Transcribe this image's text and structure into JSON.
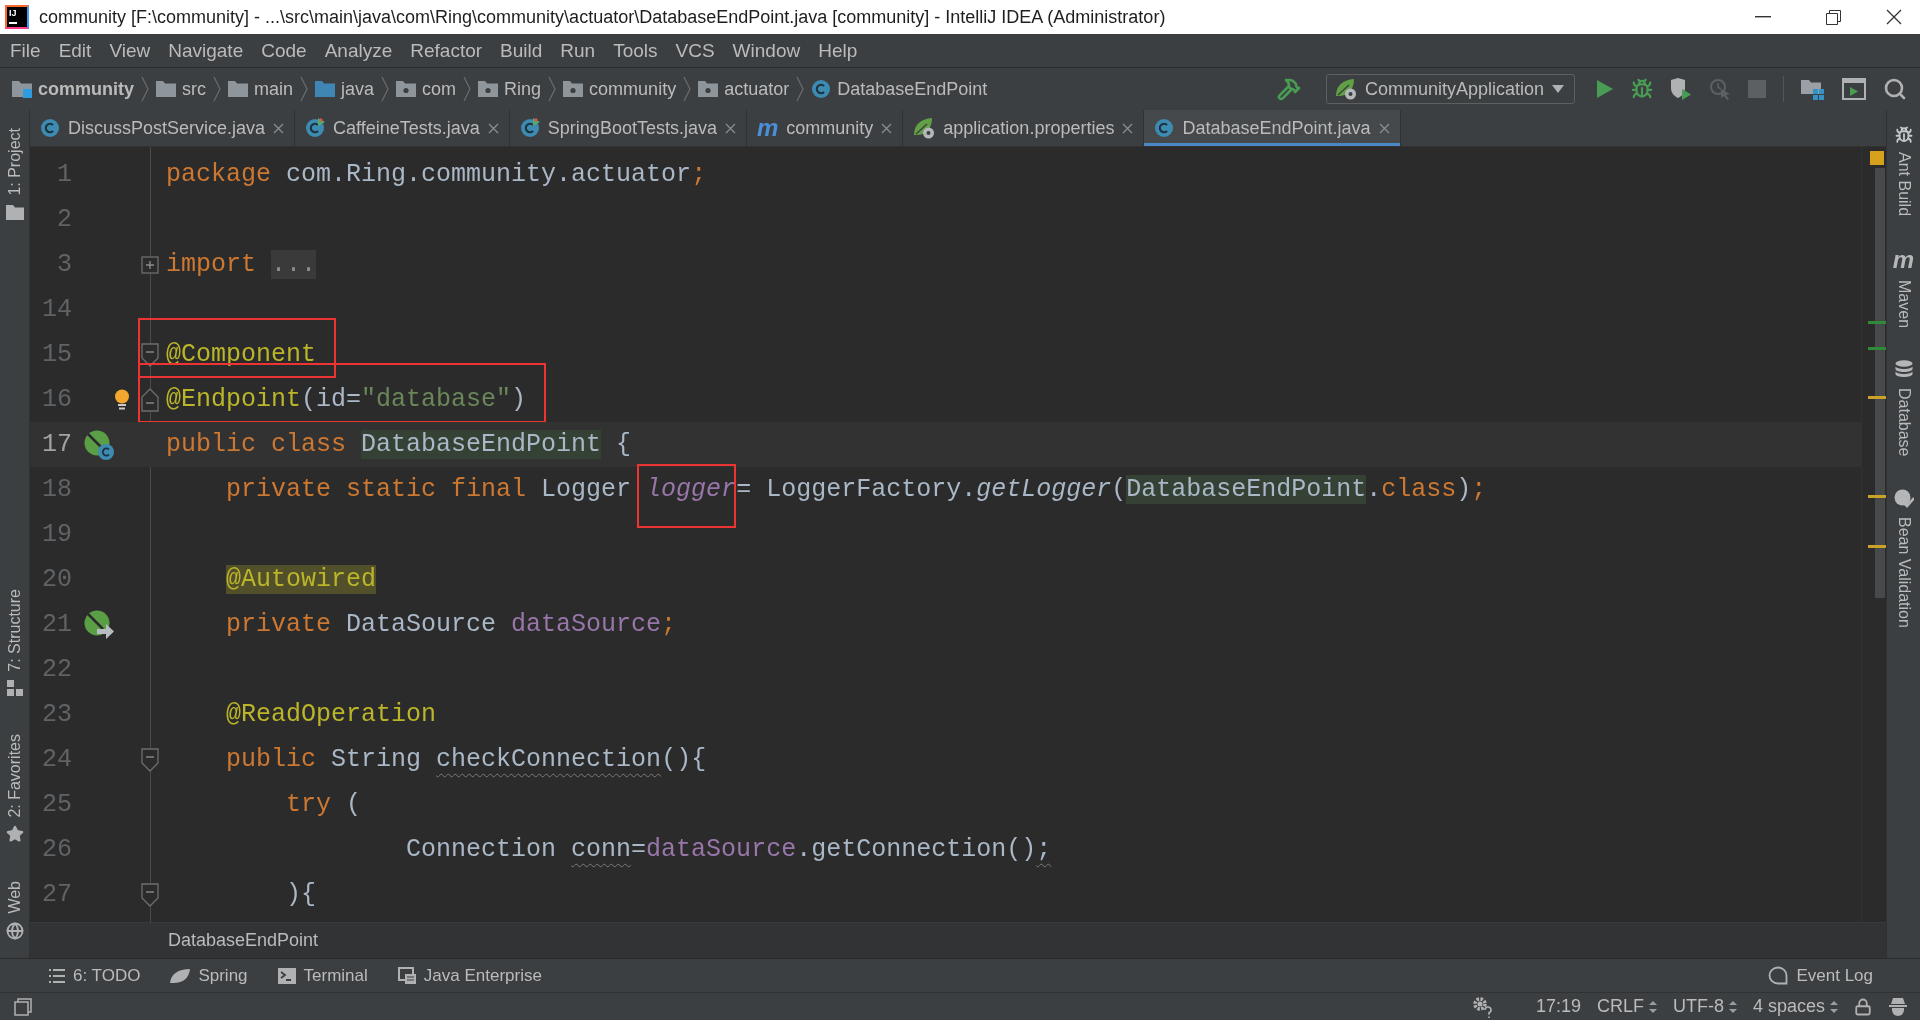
{
  "title_bar": {
    "logo_text": "IJ",
    "title": "community [F:\\community] - ...\\src\\main\\java\\com\\Ring\\community\\actuator\\DatabaseEndPoint.java [community] - IntelliJ IDEA (Administrator)"
  },
  "menu": [
    "File",
    "Edit",
    "View",
    "Navigate",
    "Code",
    "Analyze",
    "Refactor",
    "Build",
    "Run",
    "Tools",
    "VCS",
    "Window",
    "Help"
  ],
  "navigation": {
    "breadcrumbs": [
      {
        "label": "community",
        "kind": "module"
      },
      {
        "label": "src",
        "kind": "folder"
      },
      {
        "label": "main",
        "kind": "folder"
      },
      {
        "label": "java",
        "kind": "source-folder"
      },
      {
        "label": "com",
        "kind": "package"
      },
      {
        "label": "Ring",
        "kind": "package"
      },
      {
        "label": "community",
        "kind": "package"
      },
      {
        "label": "actuator",
        "kind": "package"
      },
      {
        "label": "DatabaseEndPoint",
        "kind": "class"
      }
    ],
    "toolbar": {
      "build": {
        "disabled": false
      },
      "run_config": {
        "label": "CommunityApplication"
      },
      "actions": [
        {
          "kind": "run",
          "disabled": false
        },
        {
          "kind": "debug",
          "disabled": false
        },
        {
          "kind": "coverage",
          "disabled": false
        },
        {
          "kind": "profile",
          "disabled": true
        },
        {
          "kind": "stop",
          "disabled": true
        }
      ],
      "tools": [
        {
          "kind": "project-structure"
        },
        {
          "kind": "run-window"
        },
        {
          "kind": "search"
        }
      ]
    }
  },
  "left_tool_strip": {
    "top": [
      {
        "label": "1: Project",
        "kind": "project"
      }
    ],
    "bottom": [
      {
        "label": "7: Structure",
        "kind": "structure"
      },
      {
        "label": "2: Favorites",
        "kind": "favorites"
      },
      {
        "label": "Web",
        "kind": "web"
      }
    ]
  },
  "tabs": [
    {
      "label": "DiscussPostService.java",
      "kind": "class",
      "selected": false
    },
    {
      "label": "CaffeineTests.java",
      "kind": "test",
      "selected": false
    },
    {
      "label": "SpringBootTests.java",
      "kind": "test",
      "selected": false
    },
    {
      "label": "community",
      "kind": "maven",
      "glyph": "m",
      "selected": false
    },
    {
      "label": "application.properties",
      "kind": "spring-config",
      "selected": false
    },
    {
      "label": "DatabaseEndPoint.java",
      "kind": "class",
      "selected": true
    }
  ],
  "editor": {
    "lines": [
      {
        "number": "1",
        "current": false,
        "marked": false,
        "tokens": [
          {
            "text": "package",
            "kind": "keyword"
          },
          {
            "text": " com.Ring.community.actuator",
            "kind": "plain"
          },
          {
            "text": ";",
            "kind": "keyword"
          }
        ]
      },
      {
        "number": "2",
        "current": false,
        "marked": false
      },
      {
        "number": "3",
        "current": false,
        "marked": false,
        "fold": {
          "kind": "expand"
        },
        "tokens": [
          {
            "text": "import ",
            "kind": "keyword"
          },
          {
            "text": "...",
            "kind": "folded"
          }
        ]
      },
      {
        "number": "14",
        "current": false,
        "marked": false
      },
      {
        "number": "15",
        "current": false,
        "marked": true,
        "fold": {
          "kind": "collapse"
        },
        "tokens": [
          {
            "text": "@Component",
            "kind": "annotation"
          }
        ]
      },
      {
        "number": "16",
        "current": false,
        "marked": true,
        "bulb": true,
        "fold": {
          "kind": "end"
        },
        "tokens": [
          {
            "text": "@Endpoint",
            "kind": "annotation"
          },
          {
            "text": "(id=",
            "kind": "plain"
          },
          {
            "text": "\"database\"",
            "kind": "string"
          },
          {
            "text": ")",
            "kind": "plain"
          }
        ]
      },
      {
        "number": "17",
        "current": true,
        "marked": false,
        "gutter_icon": {
          "kind": "bean"
        },
        "tokens": [
          {
            "text": "public class ",
            "kind": "keyword"
          },
          {
            "text": "DatabaseEndPoint",
            "kind": "usage"
          },
          {
            "text": " {",
            "kind": "plain"
          }
        ]
      },
      {
        "number": "18",
        "current": false,
        "marked": false,
        "tokens": [
          {
            "text": "    private static final ",
            "kind": "keyword"
          },
          {
            "text": "Logger ",
            "kind": "plain"
          },
          {
            "text": "logger",
            "kind": "static-field",
            "marked": true
          },
          {
            "text": "= LoggerFactory.",
            "kind": "plain"
          },
          {
            "text": "getLogger",
            "kind": "static-call"
          },
          {
            "text": "(",
            "kind": "plain"
          },
          {
            "text": "DatabaseEndPoint",
            "kind": "usage"
          },
          {
            "text": ".",
            "kind": "plain"
          },
          {
            "text": "class",
            "kind": "keyword"
          },
          {
            "text": ")",
            "kind": "plain"
          },
          {
            "text": ";",
            "kind": "keyword"
          }
        ]
      },
      {
        "number": "19",
        "current": false,
        "marked": false
      },
      {
        "number": "20",
        "current": false,
        "marked": false,
        "tokens": [
          {
            "text": "    @Autowired",
            "kind": "warned-annotation"
          }
        ]
      },
      {
        "number": "21",
        "current": false,
        "marked": false,
        "gutter_icon": {
          "kind": "autowired"
        },
        "tokens": [
          {
            "text": "    private ",
            "kind": "keyword"
          },
          {
            "text": "DataSource ",
            "kind": "plain"
          },
          {
            "text": "dataSource",
            "kind": "field"
          },
          {
            "text": ";",
            "kind": "keyword"
          }
        ]
      },
      {
        "number": "22",
        "current": false,
        "marked": false
      },
      {
        "number": "23",
        "current": false,
        "marked": false,
        "tokens": [
          {
            "text": "    @ReadOperation",
            "kind": "annotation"
          }
        ]
      },
      {
        "number": "24",
        "current": false,
        "marked": false,
        "fold": {
          "kind": "collapse"
        },
        "tokens": [
          {
            "text": "    public ",
            "kind": "keyword"
          },
          {
            "text": "String ",
            "kind": "plain"
          },
          {
            "text": "checkConnection",
            "kind": "plain",
            "squiggle": true
          },
          {
            "text": "(){",
            "kind": "plain"
          }
        ]
      },
      {
        "number": "25",
        "current": false,
        "marked": false,
        "tokens": [
          {
            "text": "        try ",
            "kind": "keyword"
          },
          {
            "text": "(",
            "kind": "plain"
          }
        ]
      },
      {
        "number": "26",
        "current": false,
        "marked": false,
        "tokens": [
          {
            "text": "                Connection ",
            "kind": "plain"
          },
          {
            "text": "conn",
            "kind": "plain",
            "squiggle": true
          },
          {
            "text": "=",
            "kind": "plain"
          },
          {
            "text": "dataSource",
            "kind": "field"
          },
          {
            "text": ".getConnection()",
            "kind": "plain"
          },
          {
            "text": ";",
            "kind": "plain",
            "squiggle": true
          }
        ]
      },
      {
        "number": "27",
        "current": false,
        "marked": false,
        "fold": {
          "kind": "collapse"
        },
        "tokens": [
          {
            "text": "        ){",
            "kind": "plain"
          }
        ]
      }
    ],
    "error_stripe": [
      {
        "color": "#2f8a3a"
      },
      {
        "color": "#2f8a3a"
      },
      {
        "color": "#c9a227"
      },
      {
        "color": "#c9a227"
      },
      {
        "color": "#c9a227"
      }
    ]
  },
  "editor_breadcrumb": "DatabaseEndPoint",
  "right_tool_strip": [
    {
      "label": "Ant Build",
      "kind": "ant"
    },
    {
      "label": "Maven",
      "kind": "maven",
      "glyph": "m"
    },
    {
      "label": "Database",
      "kind": "database"
    },
    {
      "label": "Bean Validation",
      "kind": "bean-validation"
    }
  ],
  "bottom_tools": [
    {
      "label": "6: TODO",
      "kind": "todo"
    },
    {
      "label": "Spring",
      "kind": "spring"
    },
    {
      "label": "Terminal",
      "kind": "terminal"
    },
    {
      "label": "Java Enterprise",
      "kind": "java-enterprise"
    }
  ],
  "event_log": {
    "label": "Event Log"
  },
  "status_bar": {
    "caret_position": "17:19",
    "line_separator": "CRLF",
    "encoding": "UTF-8",
    "indent": "4 spaces"
  }
}
